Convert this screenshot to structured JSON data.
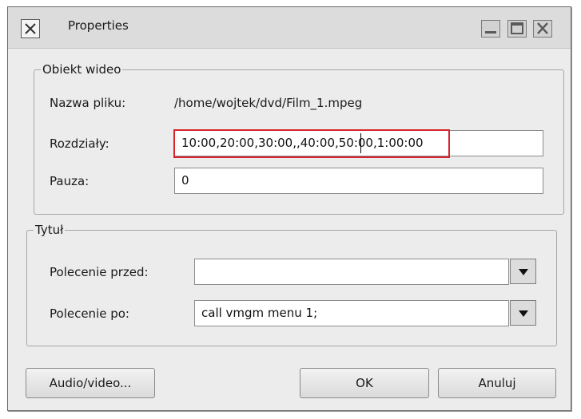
{
  "window": {
    "title": "Properties",
    "app_icon": "x-icon",
    "controls": [
      "minimize-icon",
      "maximize-icon",
      "close-icon"
    ]
  },
  "video_object": {
    "legend": "Obiekt wideo",
    "filename_label": "Nazwa pliku:",
    "filename_value": "/home/wojtek/dvd/Film_1.mpeg",
    "chapters_label": "Rozdziały:",
    "chapters_value": "10:00,20:00,30:00,,40:00,50:00,1:00:00",
    "pause_label": "Pauza:",
    "pause_value": "0"
  },
  "title_group": {
    "legend": "Tytuł",
    "pre_command_label": "Polecenie przed:",
    "pre_command_value": "",
    "post_command_label": "Polecenie po:",
    "post_command_value": "call vmgm menu 1;"
  },
  "buttons": {
    "audio_video": "Audio/video...",
    "ok": "OK",
    "cancel": "Anuluj"
  },
  "colors": {
    "highlight": "#d8242a",
    "window_bg": "#ececec"
  }
}
